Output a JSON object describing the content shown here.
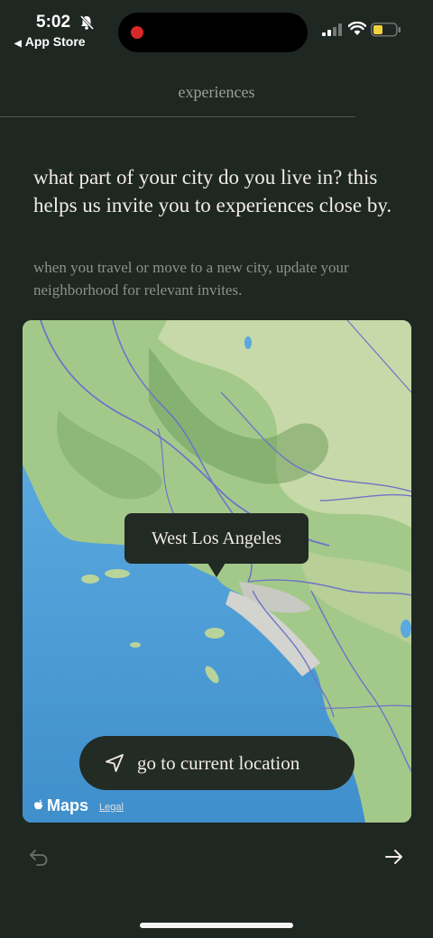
{
  "status_bar": {
    "time": "5:02",
    "back_label": "App Store"
  },
  "header": {
    "title": "experiences"
  },
  "content": {
    "question": "what part of your city do you live in? this helps us invite you to experiences close by.",
    "subtext": "when you travel or move to a new city, update your neighborhood for relevant invites."
  },
  "map": {
    "callout_label": "West Los Angeles",
    "location_button_label": "go to current location",
    "attribution_label": "Maps",
    "legal_label": "Legal"
  },
  "colors": {
    "background": "#1f2722",
    "card": "#222a24",
    "water": "#4f9ed6",
    "land": "#8fbe7e"
  },
  "icons": {
    "back": "undo-arrow-icon",
    "next": "arrow-right-icon",
    "location": "location-arrow-icon"
  }
}
